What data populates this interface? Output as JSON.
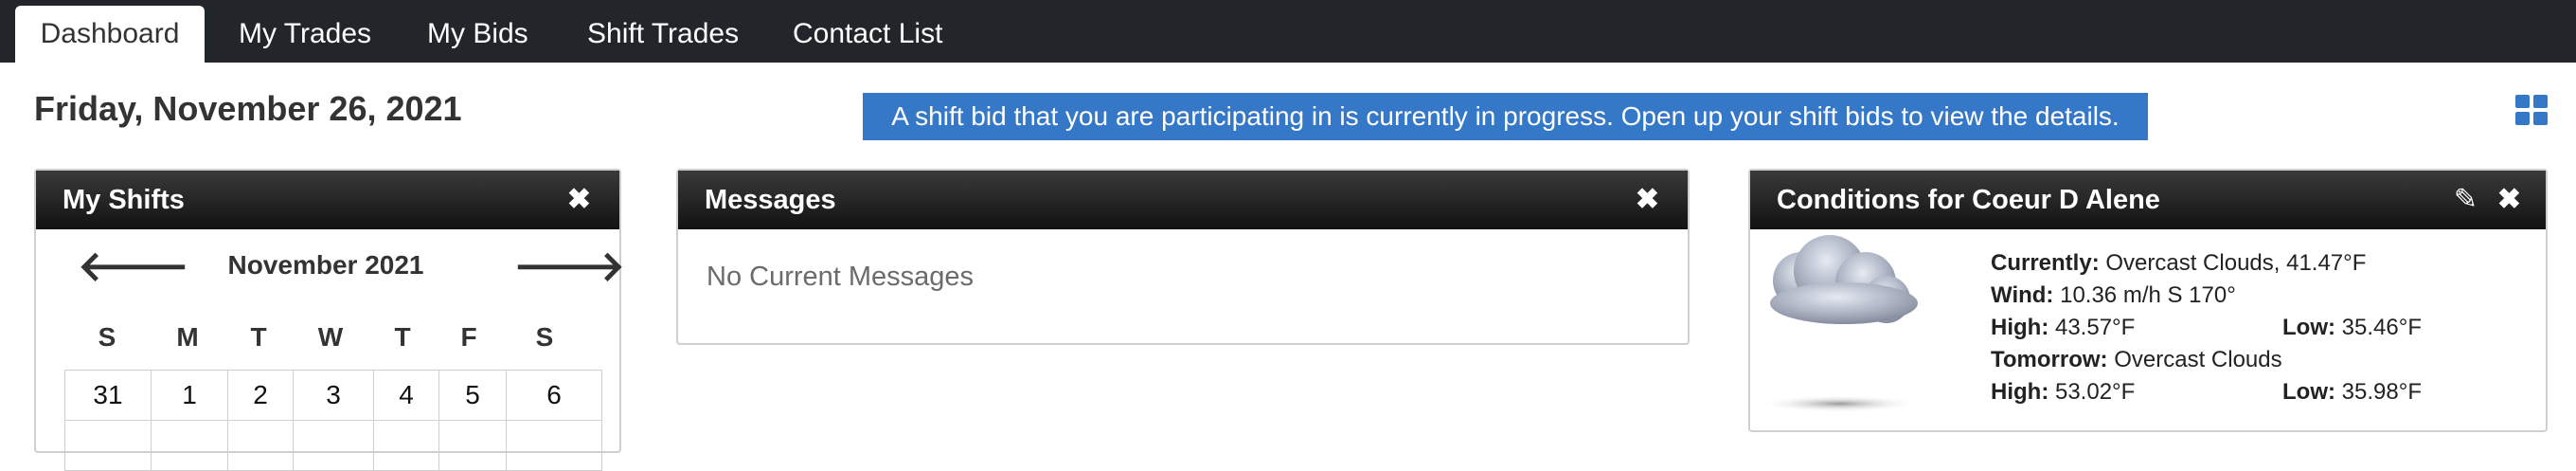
{
  "nav": {
    "tabs": [
      {
        "label": "Dashboard"
      },
      {
        "label": "My Trades"
      },
      {
        "label": "My Bids"
      },
      {
        "label": "Shift Trades"
      },
      {
        "label": "Contact List"
      }
    ]
  },
  "header": {
    "date": "Friday, November 26, 2021",
    "alert": "A shift bid that you are participating in is currently in progress. Open up your shift bids to view the details."
  },
  "shifts_panel": {
    "title": "My Shifts",
    "close": "✖",
    "prev": "🡐",
    "next": "🡒",
    "month": "November 2021",
    "days": [
      "S",
      "M",
      "T",
      "W",
      "T",
      "F",
      "S"
    ],
    "week1": [
      "31",
      "1",
      "2",
      "3",
      "4",
      "5",
      "6"
    ]
  },
  "messages_panel": {
    "title": "Messages",
    "close": "✖",
    "body": "No Current Messages"
  },
  "weather_panel": {
    "title": "Conditions for Coeur D Alene",
    "close": "✖",
    "edit": "✎",
    "currently_label": "Currently:",
    "currently_value": "Overcast Clouds, 41.47°F",
    "wind_label": "Wind:",
    "wind_value": "10.36 m/h S 170°",
    "high_label": "High:",
    "high_value": "43.57°F",
    "low_label": "Low:",
    "low_value": "35.46°F",
    "tomorrow_label": "Tomorrow:",
    "tomorrow_value": "Overcast Clouds",
    "t_high_label": "High:",
    "t_high_value": "53.02°F",
    "t_low_label": "Low:",
    "t_low_value": "35.98°F"
  }
}
